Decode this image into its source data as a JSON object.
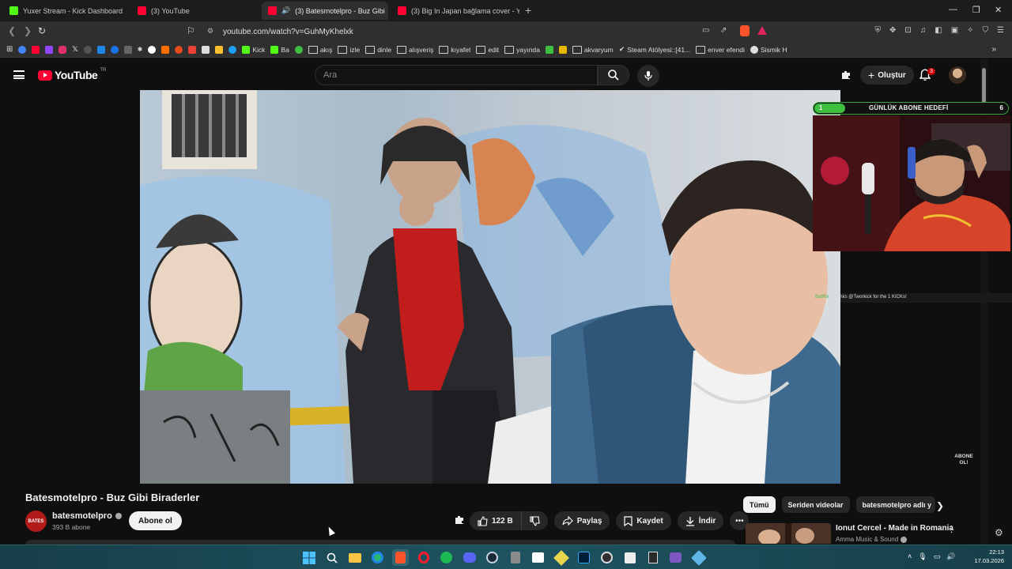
{
  "browser": {
    "tabs": [
      {
        "title": "Yuxer Stream - Kick Dashboard",
        "favicon": "kick-icon",
        "active": false
      },
      {
        "title": "(3) YouTube",
        "favicon": "youtube-icon",
        "active": false
      },
      {
        "title": "(3) Batesmotelpro - Buz Gibi",
        "favicon": "youtube-icon",
        "active": true
      },
      {
        "title": "(3) Big In Japan bağlama cover - You",
        "favicon": "youtube-icon",
        "active": false
      }
    ],
    "url": "youtube.com/watch?v=GuhMyKhelxk",
    "bookmarks": {
      "kick_label": "Kick",
      "ba_label": "Ba",
      "folders": [
        "akış",
        "izle",
        "dinle",
        "alışveriş",
        "kıyafet",
        "edit",
        "yayında",
        "akvaryum"
      ],
      "steam_label": "Steam Atölyesi::[41...",
      "enver_label": "enver efendi",
      "sismik_label": "Sismik H"
    }
  },
  "youtube": {
    "logo_text": "YouTube",
    "country_code": "TR",
    "search_placeholder": "Ara",
    "create_label": "Oluştur",
    "notification_count": "3"
  },
  "overlay": {
    "goal_label": "GÜNLÜK ABONE HEDEFİ",
    "goal_current": "1",
    "goal_target": "6",
    "goal_progress": 0.16,
    "chat_bot": "BotRix",
    "chat_text": ": Thanks @Tworkick for the 1 KICKs!",
    "abone_ol_line1": "ABONE",
    "abone_ol_line2": "OL!"
  },
  "video": {
    "title": "Batesmotelpro - Buz Gibi Biraderler",
    "channel_avatar_text": "BATES",
    "channel_name": "batesmotelpro",
    "subscribers": "393 B abone",
    "subscribe_label": "Abone ol",
    "likes": "122 B",
    "share_label": "Paylaş",
    "save_label": "Kaydet",
    "download_label": "İndir"
  },
  "related": {
    "chips": [
      "Tümü",
      "Seriden videolar",
      "batesmotelpro adlı y"
    ],
    "first_title": "Ionut Cercel - Made in Romania",
    "first_channel": "Amma Music & Sound"
  },
  "taskbar": {
    "time": "22:13",
    "date": "17.03.2026"
  },
  "colors": {
    "background": "#0f0f0f",
    "youtube_red": "#ff0033",
    "kick_green": "#53fc18",
    "taskbar": "#1e5461"
  }
}
